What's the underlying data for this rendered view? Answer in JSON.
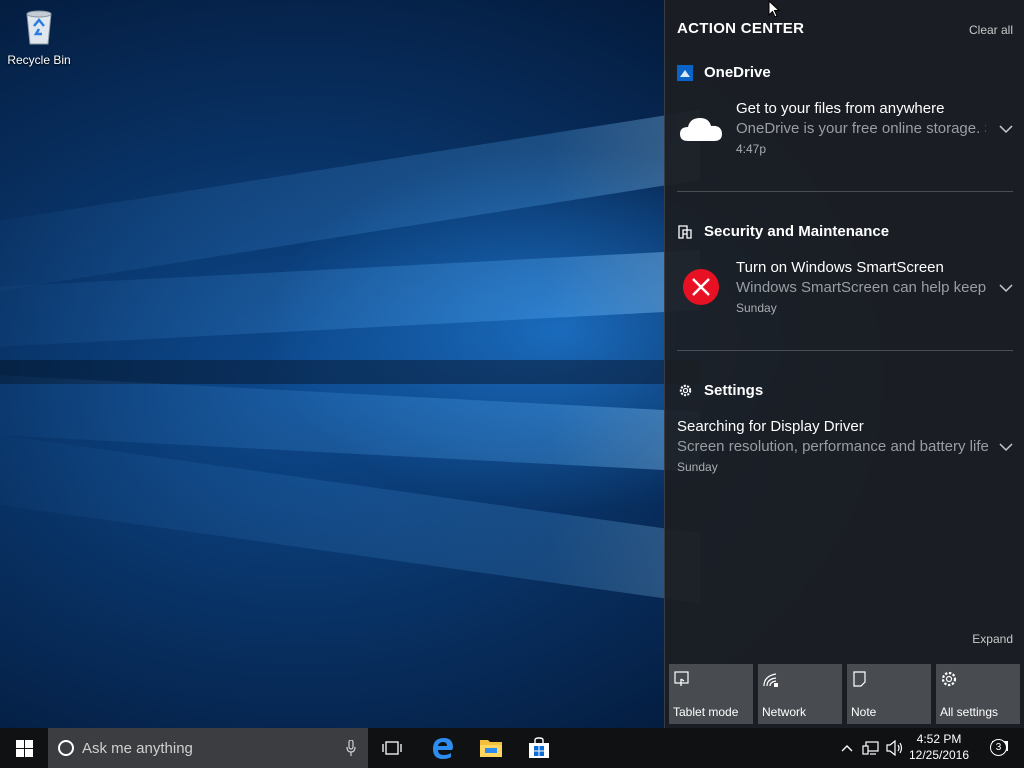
{
  "desktop": {
    "icons": [
      {
        "label": "Recycle Bin",
        "icon": "recycle-bin-icon"
      }
    ]
  },
  "action_center": {
    "title": "ACTION CENTER",
    "clear_all": "Clear all",
    "expand": "Expand",
    "groups": [
      {
        "app": "OneDrive",
        "icon": "onedrive-app-icon",
        "notification": {
          "title": "Get to your files from anywhere",
          "body": "OneDrive is your free online storage. Save your files",
          "time": "4:47p",
          "image": "cloud-icon"
        }
      },
      {
        "app": "Security and Maintenance",
        "icon": "security-maintenance-icon",
        "notification": {
          "title": "Turn on Windows SmartScreen",
          "body": "Windows SmartScreen can help keep your PC safe",
          "time": "Sunday",
          "image": "error-x-icon",
          "error_color": "#e81123"
        }
      },
      {
        "app": "Settings",
        "icon": "gear-icon",
        "notification": {
          "title": "Searching for Display Driver",
          "body": "Screen resolution, performance and battery life",
          "time": "Sunday"
        }
      }
    ],
    "quick_actions": [
      {
        "label": "Tablet mode",
        "icon": "tablet-mode-icon"
      },
      {
        "label": "Network",
        "icon": "network-icon"
      },
      {
        "label": "Note",
        "icon": "note-icon"
      },
      {
        "label": "All settings",
        "icon": "gear-icon"
      }
    ]
  },
  "taskbar": {
    "search_placeholder": "Ask me anything",
    "pinned": [
      "task-view-icon",
      "edge-icon",
      "file-explorer-icon",
      "store-icon"
    ],
    "clock": {
      "time": "4:52 PM",
      "date": "12/25/2016"
    },
    "notification_count": "3",
    "accent_color": "#0078d7"
  }
}
